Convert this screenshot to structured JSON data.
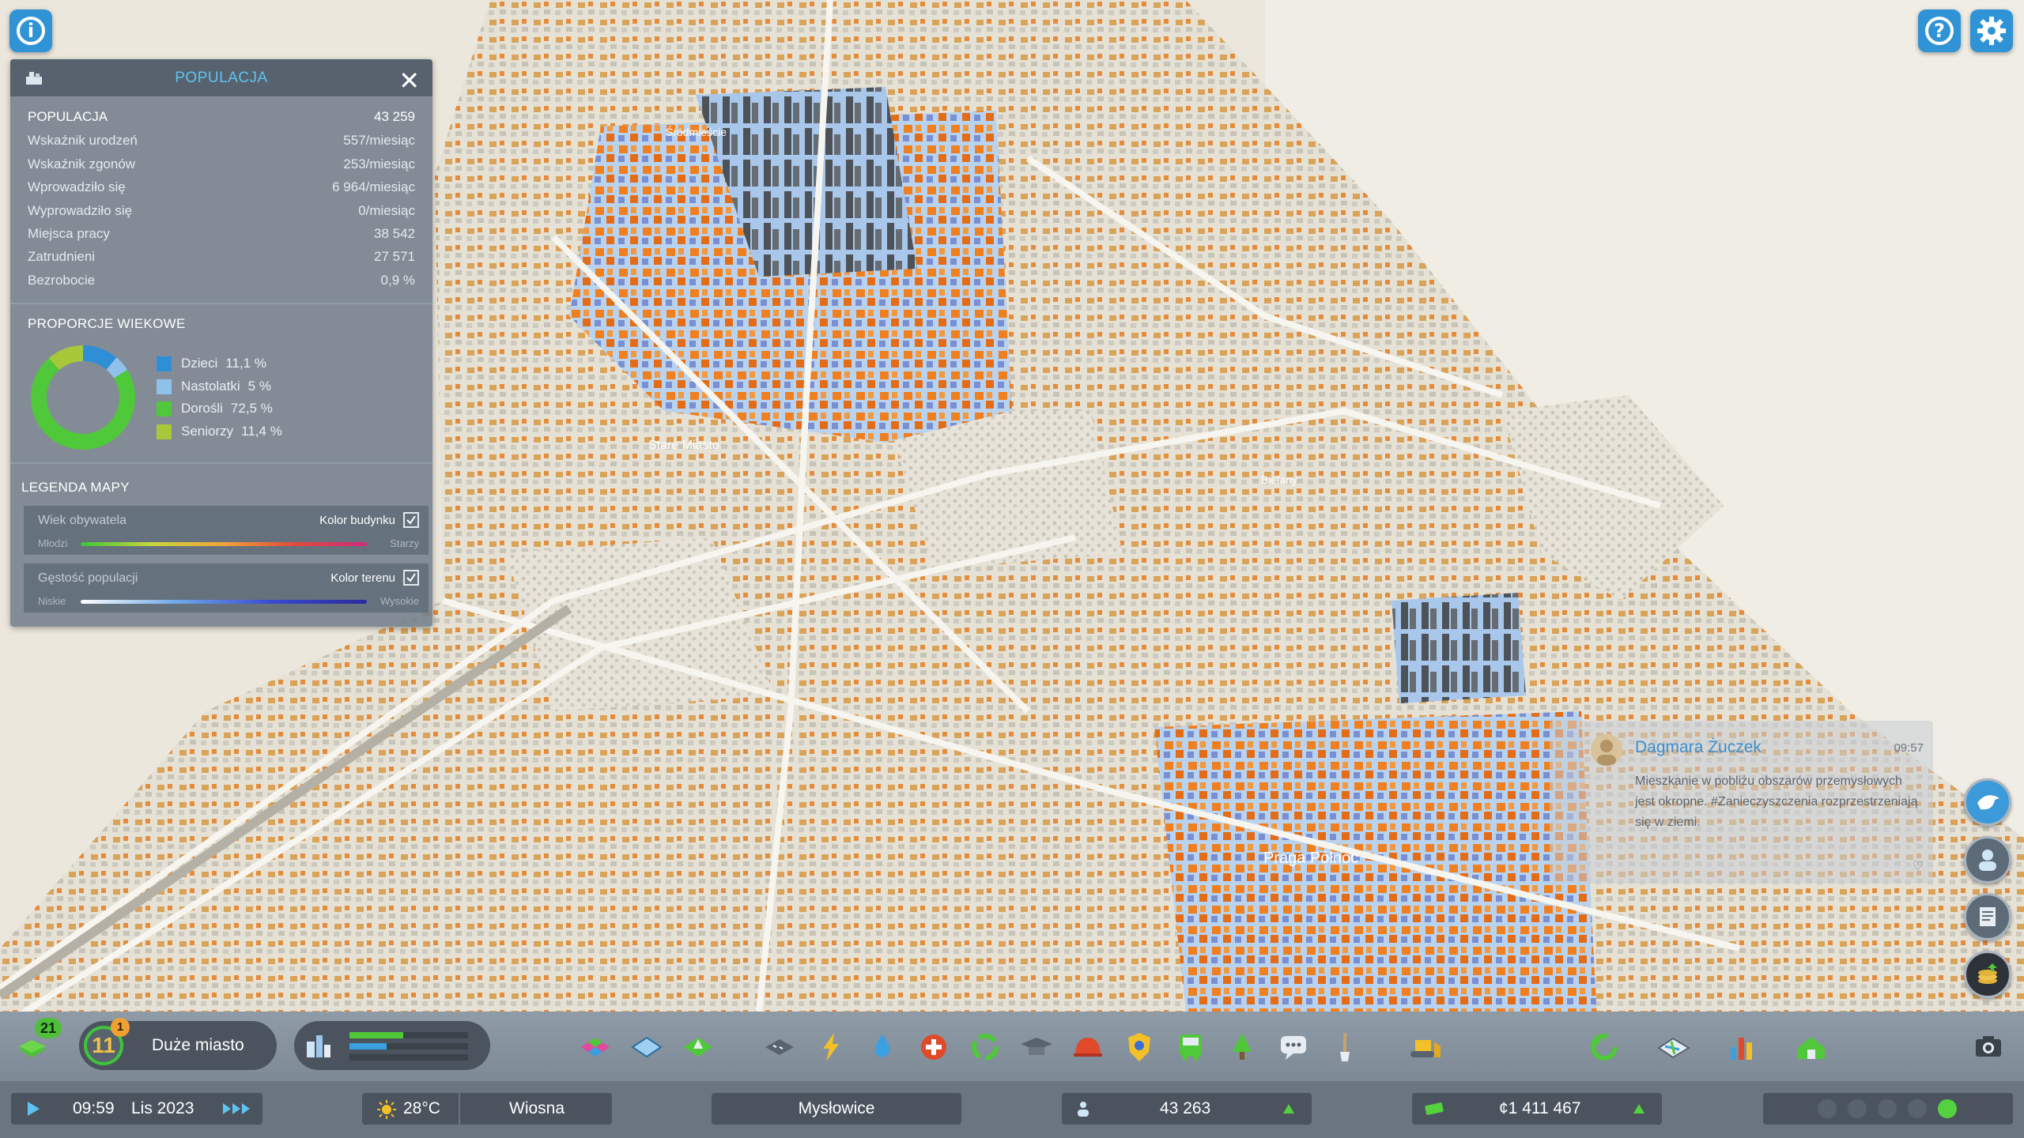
{
  "panel": {
    "title": "POPULACJA",
    "stats": [
      {
        "label": "POPULACJA",
        "value": "43 259"
      },
      {
        "label": "Wskaźnik urodzeń",
        "value": "557/miesiąc"
      },
      {
        "label": "Wskaźnik zgonów",
        "value": "253/miesiąc"
      },
      {
        "label": "Wprowadziło się",
        "value": "6 964/miesiąc"
      },
      {
        "label": "Wyprowadziło się",
        "value": "0/miesiąc"
      },
      {
        "label": "Miejsca pracy",
        "value": "38 542"
      },
      {
        "label": "Zatrudnieni",
        "value": "27 571"
      },
      {
        "label": "Bezrobocie",
        "value": "0,9 %"
      }
    ],
    "age_title": "PROPORCJE WIEKOWE",
    "ages": [
      {
        "label": "Dzieci",
        "value": "11,1 %",
        "fraction": 0.111,
        "color": "#2f8fd6"
      },
      {
        "label": "Nastolatki",
        "value": "5 %",
        "fraction": 0.05,
        "color": "#8fc1ea"
      },
      {
        "label": "Dorośli",
        "value": "72,5 %",
        "fraction": 0.725,
        "color": "#4fc83a"
      },
      {
        "label": "Seniorzy",
        "value": "11,4 %",
        "fraction": 0.114,
        "color": "#a8c83a"
      }
    ],
    "legend_title": "LEGENDA MAPY",
    "legend": [
      {
        "name": "Wiek obywatela",
        "option": "Kolor budynku",
        "min": "Młodzi",
        "max": "Starzy"
      },
      {
        "name": "Gęstość populacji",
        "option": "Kolor terenu",
        "min": "Niskie",
        "max": "Wysokie"
      }
    ]
  },
  "map_labels": {
    "district_a": "Stare Miasto",
    "district_b": "Praga Północ",
    "district_c": "Bielany",
    "district_d": "Śródmieście"
  },
  "chirp": {
    "author": "Dagmara Żuczek",
    "time": "09:57",
    "text": "Mieszkanie w pobliżu obszarów przemysłowych jest okropne. #Zanieczyszczenia rozprzestrzeniają się w ziemi."
  },
  "toolbar": {
    "xp_badge": "21",
    "level": "11",
    "level_badge": "1",
    "city_tier": "Duże miasto",
    "progress_fraction": 0.45
  },
  "status": {
    "time": "09:59",
    "date": "Lis 2023",
    "temperature": "28°C",
    "season": "Wiosna",
    "city_name": "Mysłowice",
    "population": "43 263",
    "money": "¢1 411 467"
  },
  "colors": {
    "accent": "#2f93d6",
    "up": "#55d13f"
  }
}
